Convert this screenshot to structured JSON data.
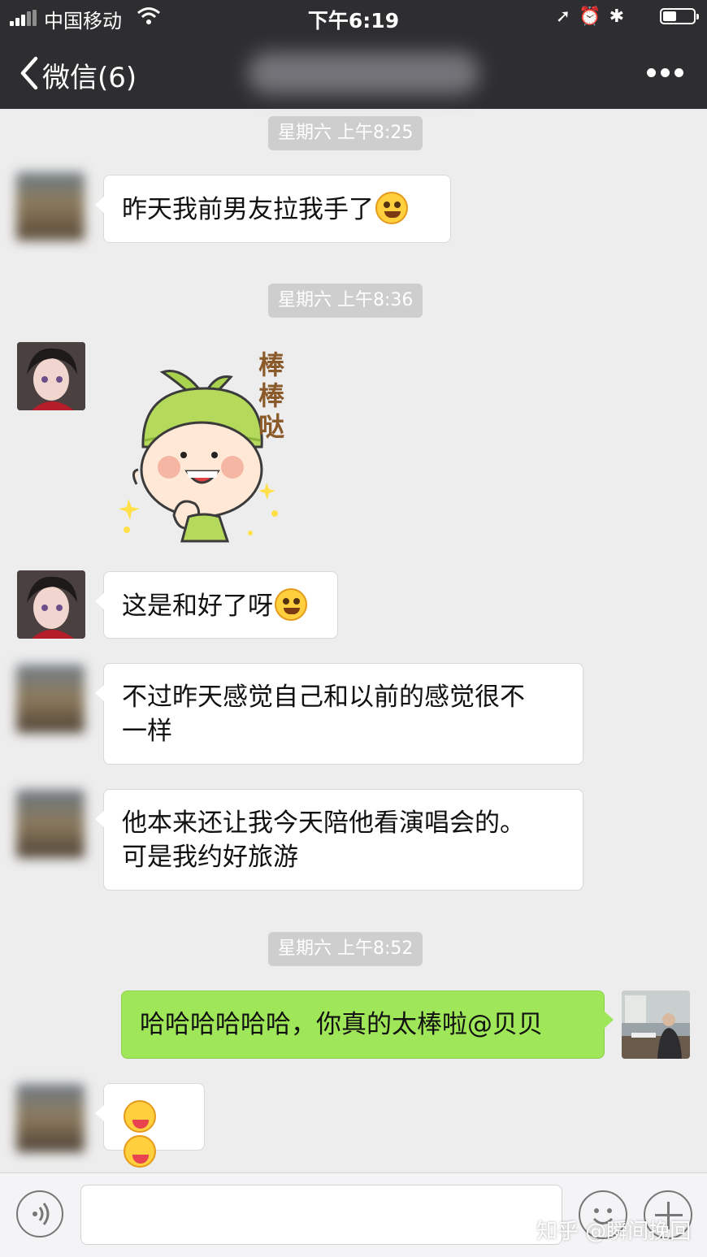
{
  "status_bar": {
    "carrier": "中国移动",
    "time": "下午6:19",
    "icons": [
      "location-arrow-icon",
      "alarm-icon",
      "bluetooth-icon",
      "battery-icon"
    ]
  },
  "nav": {
    "back_label": "微信(6)",
    "title": "",
    "more_icon": "more-dots-icon"
  },
  "messages": [
    {
      "type": "timestamp",
      "text": "星期六 上午8:25"
    },
    {
      "type": "text",
      "side": "left",
      "avatar": "blurred",
      "text": "昨天我前男友拉我手了",
      "emoji": "smirk-emoji"
    },
    {
      "type": "timestamp",
      "text": "星期六 上午8:36"
    },
    {
      "type": "sticker",
      "side": "left",
      "avatar": "anime-girl",
      "caption": "棒棒哒"
    },
    {
      "type": "text",
      "side": "left",
      "avatar": "anime-girl",
      "text": "这是和好了呀",
      "emoji": "grin-emoji"
    },
    {
      "type": "text",
      "side": "left",
      "avatar": "blurred",
      "line1": "不过昨天感觉自己和以前的感觉很不",
      "line2": "一样"
    },
    {
      "type": "text",
      "side": "left",
      "avatar": "blurred",
      "line1": "他本来还让我今天陪他看演唱会的。",
      "line2": "可是我约好旅游"
    },
    {
      "type": "timestamp",
      "text": "星期六 上午8:52"
    },
    {
      "type": "text",
      "side": "right",
      "avatar": "photo",
      "text": "哈哈哈哈哈哈，你真的太棒啦@贝贝"
    },
    {
      "type": "emoji-only",
      "side": "left",
      "avatar": "blurred",
      "emojis": [
        "tongue-wink-emoji",
        "tongue-wink-emoji"
      ]
    }
  ],
  "input_bar": {
    "voice_icon": "voice-icon",
    "emoji_icon": "emoji-icon",
    "plus_icon": "plus-icon",
    "watermark": "知乎 @瞬间挽回"
  },
  "colors": {
    "nav_bg": "#2e2e31",
    "chat_bg": "#ededed",
    "bubble_in": "#ffffff",
    "bubble_out": "#9fe658",
    "timestamp_bg": "#cecece"
  }
}
